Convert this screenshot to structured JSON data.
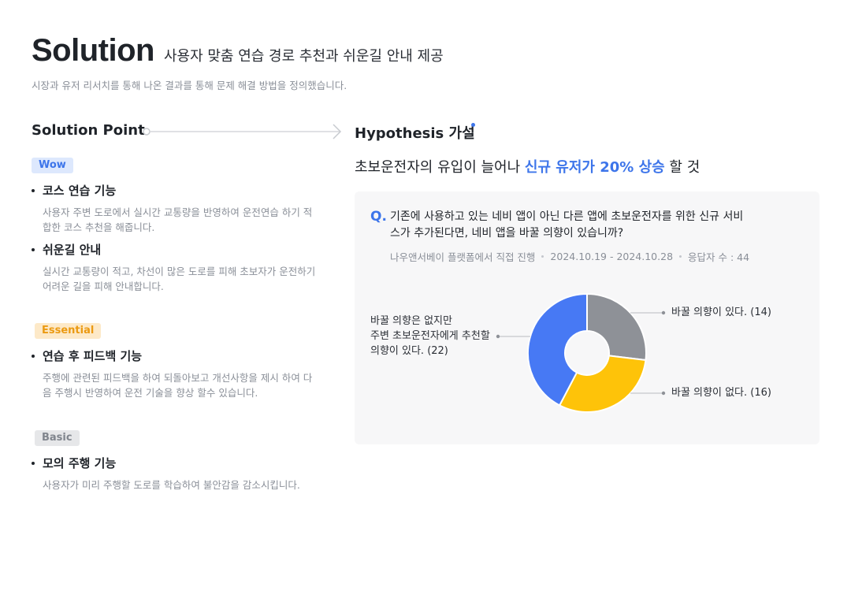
{
  "header": {
    "title": "Solution",
    "subtitle": "사용자 맞춤 연습 경로 추천과 쉬운길 안내 제공",
    "description": "시장과 유저 리서치를 통해 나온 결과를 통해 문제 해결 방법을 정의했습니다."
  },
  "solution_point": {
    "heading": "Solution Point",
    "tags": {
      "wow": "Wow",
      "essential": "Essential",
      "basic": "Basic"
    },
    "items": [
      {
        "title": "코스 연습 기능",
        "desc": "사용자 주변 도로에서 실시간 교통량을 반영하여 운전연습 하기 적합한 코스 추천을 해줍니다."
      },
      {
        "title": "쉬운길 안내",
        "desc": "실시간 교통량이 적고, 차선이 많은 도로를 피해 초보자가 운전하기 어려운 길을 피해 안내합니다."
      },
      {
        "title": "연습 후 피드백 기능",
        "desc": "주행에 관련된 피드백을 하여 되돌아보고 개선사항을 제시 하여 다음 주행시 반영하여 운전 기술을 향상 할수 있습니다."
      },
      {
        "title": "모의 주행 기능",
        "desc": "사용자가 미리 주행할 도로를 학습하여 불안감을 감소시킵니다."
      }
    ]
  },
  "hypothesis": {
    "heading": "Hypothesis 가설",
    "text_before": "초보운전자의 유입이 늘어나 ",
    "text_highlight": "신규 유저가 20% 상승",
    "text_after": " 할 것"
  },
  "survey": {
    "q_mark": "Q.",
    "question": "기존에 사용하고 있는 네비 앱이 아닌 다른 앱에 초보운전자를 위한 신규 서비스가 추가된다면, 네비 앱을 바꿀 의향이 있습니까?",
    "meta": {
      "source": "나우앤서베이 플랫폼에서 직접 진행",
      "period": "2024.10.19 - 2024.10.28",
      "respondents": "응답자 수 : 44"
    }
  },
  "chart_data": {
    "type": "pie",
    "donut": true,
    "categories": [
      "바꿀 의향이 있다.",
      "바꿀 의향이 없다.",
      "바꿀 의향은 없지만 주변 초보운전자에게 추천할 의향이 있다."
    ],
    "values": [
      14,
      16,
      22
    ],
    "labels": [
      "바꿀 의향이 있다. (14)",
      "바꿀 의향이 없다. (16)",
      "바꿀 의향은 없지만\n주변 초보운전자에게 추천할\n의향이 있다. (22)"
    ],
    "colors": [
      "#8e9197",
      "#fec309",
      "#4779f4"
    ],
    "start": "top",
    "direction": "clockwise"
  },
  "colors": {
    "accent": "#3d75ea",
    "text": "#1f2329",
    "muted": "#8a8f98"
  }
}
